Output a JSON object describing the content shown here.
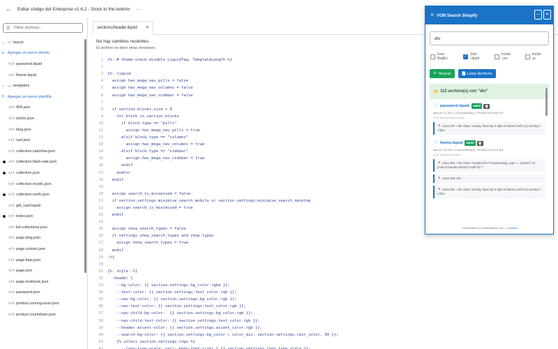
{
  "app": {
    "back_icon": "arrow-left-icon",
    "title": "Editar código del Enterprise v1.6.2 - Stock to the bottom",
    "more_icon": "ellipsis-icon"
  },
  "sidebar": {
    "filter_placeholder": "Filtrar archivos...",
    "items": [
      {
        "type": "folder",
        "label": "layout"
      },
      {
        "type": "add",
        "label": "Agregar un nuevo diseño"
      },
      {
        "type": "file",
        "label": "password.liquid",
        "dot": false
      },
      {
        "type": "file",
        "label": "theme.liquid",
        "dot": false
      },
      {
        "type": "folder",
        "label": "templates"
      },
      {
        "type": "add",
        "label": "Agregar un nuevo plantilla"
      },
      {
        "type": "file",
        "label": "404.json",
        "dot": false
      },
      {
        "type": "file",
        "label": "article.json",
        "dot": false
      },
      {
        "type": "file",
        "label": "blog.json",
        "dot": false
      },
      {
        "type": "file",
        "label": "cart.json",
        "dot": false
      },
      {
        "type": "file",
        "label": "collection.cabrinha.json",
        "dot": false
      },
      {
        "type": "file",
        "label": "collection.flash-sale.json",
        "dot": true
      },
      {
        "type": "file",
        "label": "collection.json",
        "dot": true
      },
      {
        "type": "file",
        "label": "collection.mystic.json",
        "dot": false
      },
      {
        "type": "file",
        "label": "collection.north.json",
        "dot": true
      },
      {
        "type": "file",
        "label": "gift_card.liquid",
        "dot": false
      },
      {
        "type": "file",
        "label": "index.json",
        "dot": true
      },
      {
        "type": "file",
        "label": "list-collections.json",
        "dot": false
      },
      {
        "type": "file",
        "label": "page.blog.json",
        "dot": false
      },
      {
        "type": "file",
        "label": "page.contact.json",
        "dot": false
      },
      {
        "type": "file",
        "label": "page.faqs.json",
        "dot": false
      },
      {
        "type": "file",
        "label": "page.json",
        "dot": false
      },
      {
        "type": "file",
        "label": "page.lookbook.json",
        "dot": false
      },
      {
        "type": "file",
        "label": "password.json",
        "dot": false
      },
      {
        "type": "file",
        "label": "product.coming-soon.json",
        "dot": false
      },
      {
        "type": "file",
        "label": "product.countdown.json",
        "dot": false
      }
    ]
  },
  "editor": {
    "tab_label": "sections/header.liquid",
    "no_changes": "No hay cambios recientes.",
    "no_versions": "El archivo no tiene otras versiones.",
    "lines": [
      {
        "n": "1",
        "t": "{%- # theme-check-disable LiquidTag, TemplateLength %}"
      },
      {
        "n": "2",
        "t": ""
      },
      {
        "n": "3",
        "t": "{%- liquid"
      },
      {
        "n": "4",
        "t": "  assign has_mega_nav_pills = false"
      },
      {
        "n": "5",
        "t": "  assign has_mega_nav_columns = false"
      },
      {
        "n": "6",
        "t": "  assign has_mega_nav_sidebar = false"
      },
      {
        "n": "7",
        "t": ""
      },
      {
        "n": "8",
        "t": "  if section.blocks.size > 0"
      },
      {
        "n": "9",
        "t": "    for block in section.blocks"
      },
      {
        "n": "10",
        "t": "      if block.type == \"pills\""
      },
      {
        "n": "11",
        "t": "        assign has_mega_nav_pills = true"
      },
      {
        "n": "12",
        "t": "      elsif block.type == \"columns\""
      },
      {
        "n": "13",
        "t": "        assign has_mega_nav_columns = true"
      },
      {
        "n": "14",
        "t": "      elsif block.type == \"sidebar\""
      },
      {
        "n": "15",
        "t": "        assign has_mega_nav_sidebar = true"
      },
      {
        "n": "16",
        "t": "      endif"
      },
      {
        "n": "17",
        "t": "    endfor"
      },
      {
        "n": "18",
        "t": "  endif"
      },
      {
        "n": "19",
        "t": ""
      },
      {
        "n": "20",
        "t": "  assign search_is_minimised = false"
      },
      {
        "n": "21",
        "t": "  if section.settings.minimise_search_mobile or section.settings.minimise_search_desktop"
      },
      {
        "n": "22",
        "t": "    assign search_is_minimised = true"
      },
      {
        "n": "23",
        "t": "  endif"
      },
      {
        "n": "24",
        "t": ""
      },
      {
        "n": "25",
        "t": "  assign show_search_types = false"
      },
      {
        "n": "26",
        "t": "  if settings.show_search_types and shop.types"
      },
      {
        "n": "27",
        "t": "    assign show_search_types = true"
      },
      {
        "n": "28",
        "t": "  endif"
      },
      {
        "n": "29",
        "t": "-%}"
      },
      {
        "n": "30",
        "t": ""
      },
      {
        "n": "31",
        "t": "{%- style -%}"
      },
      {
        "n": "32",
        "t": "  .header {"
      },
      {
        "n": "33",
        "t": "    --bg-color: {{ section.settings.bg_color.rgba }};"
      },
      {
        "n": "34",
        "t": "    --text-color: {{ section.settings.text_color.rgb }};"
      },
      {
        "n": "35",
        "t": "    --nav-bg-color: {{ section.settings.bg_color.rgb }};"
      },
      {
        "n": "36",
        "t": "    --nav-text-color: {{ section.settings.text_color.rgb }};"
      },
      {
        "n": "37",
        "t": "    --nav-child-bg-color:  {{ section.settings.bg_color.rgb }};"
      },
      {
        "n": "38",
        "t": "    --nav-child-text-color: {{ section.settings.text_color.rgb }};"
      },
      {
        "n": "39",
        "t": "    --header-accent-color: {{ section.settings.accent_color.rgb }};"
      },
      {
        "n": "40",
        "t": "    --search-bg-color: {{ section.settings.bg_color | color_mix: section.settings.text_color, 90 }};"
      },
      {
        "n": "41",
        "t": "    {% unless section.settings.logo %}"
      },
      {
        "n": "42",
        "t": "      --logo-type-scale: var(--body-font-size) * {{ section.settings.logo_type_scale }};"
      }
    ]
  },
  "search_panel": {
    "title": "🔍 VON Search Shopify",
    "minimize_label": "–",
    "close_label": "×",
    "query": "div",
    "options": [
      {
        "label": "User RegEx",
        "checked": false
      },
      {
        "label": "Solo .liquid",
        "checked": true
      },
      {
        "label": "Incluir .css",
        "checked": false
      },
      {
        "label": "Incluir .js",
        "checked": false
      }
    ],
    "search_button": "Buscar",
    "list_button": "Listar Archivos",
    "results_summary": "112 archivo(s) con \"div\"",
    "results": [
      {
        "name": "password.liquid",
        "badge": "ABRIR",
        "meta": "layout/ • 17 KB • 1 coincidencia(s) • Primera en línea 297",
        "path": "Ruta: layout/password.liquid",
        "matches": [
          "📍 Línea 297: • div class=\"overlay fixed top-0 right-0 bottom-0 left-0 js-overlay\"></div>"
        ]
      },
      {
        "name": "theme.liquid",
        "badge": "ABRIR",
        "meta": "layout/ • 49 KB • 3 coincidencia(s) • Primera en línea 361",
        "path": "Ruta: layout/theme.liquid",
        "matches": [
          "📍 Línea 361: • div class=\"container{% if request.page_type == 'product' %} product-breadcrumbs{% endif %}\">",
          "📍 Línea 389: div>",
          "📍 Línea 391: • div class=\"overlay fixed top-0 right-0 bottom-0 left-0 js-overlay\"></div>"
        ]
      }
    ],
    "footer_text": "Desarrollado por VisibilidadOn.com •",
    "footer_link": "Contacto"
  }
}
